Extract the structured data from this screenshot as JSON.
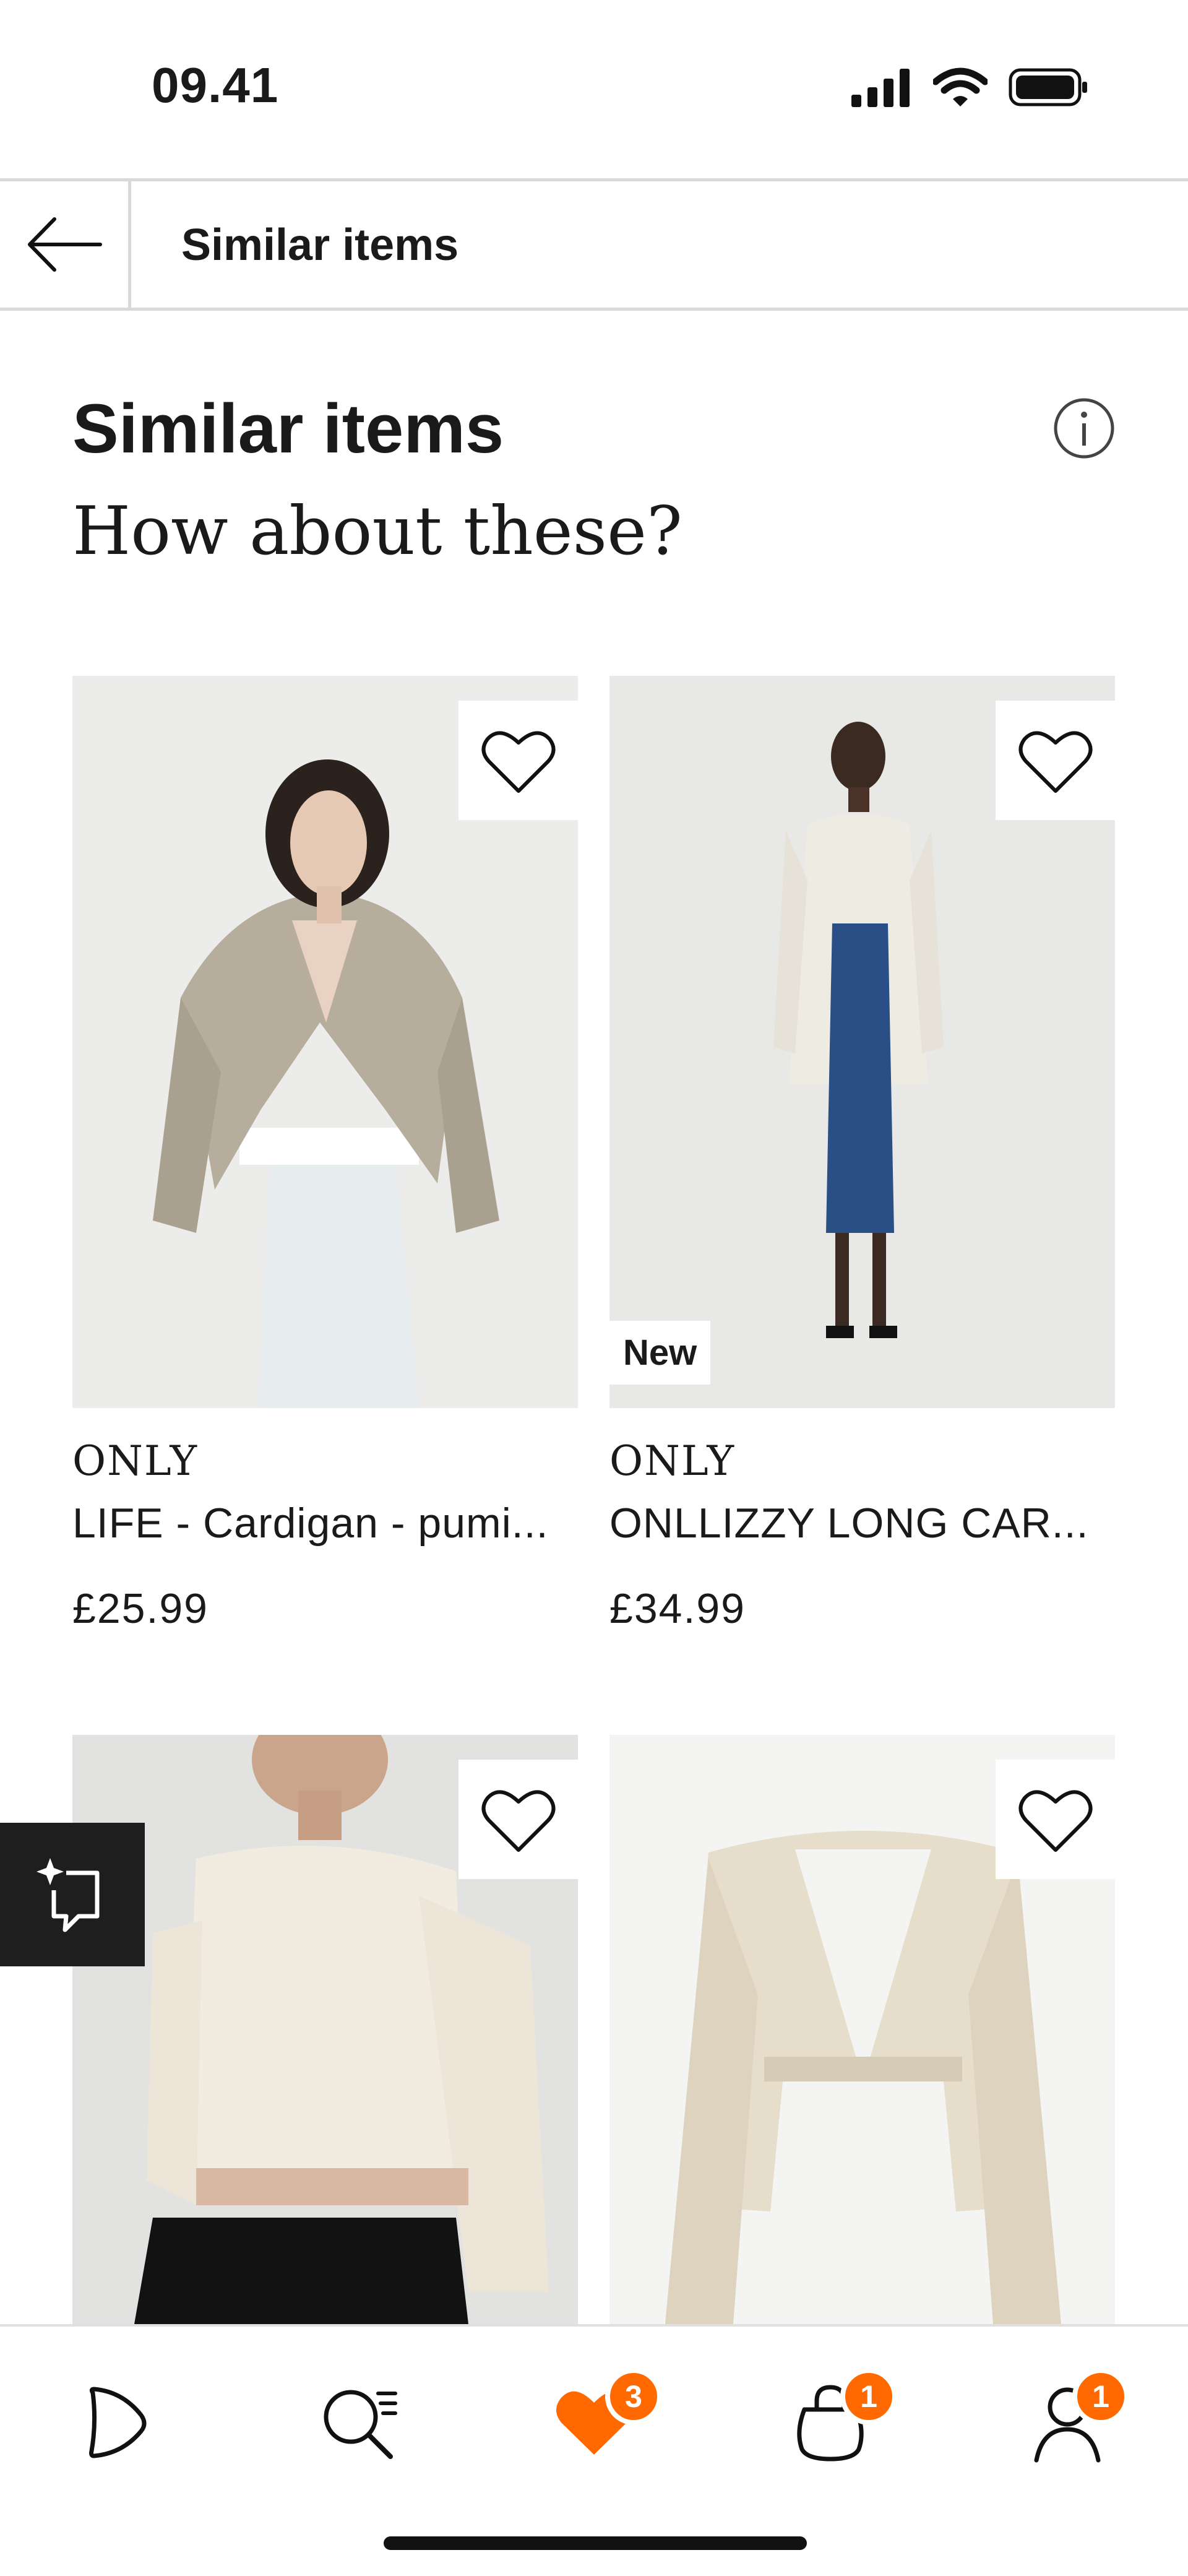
{
  "status_bar": {
    "time": "09.41"
  },
  "header": {
    "title": "Similar items"
  },
  "section": {
    "title": "Similar items",
    "subtitle": "How about these?"
  },
  "products": [
    {
      "brand": "ONLY",
      "name": "LIFE  - Cardigan - pumi...",
      "price": "£25.99",
      "badge": ""
    },
    {
      "brand": "ONLY",
      "name": "ONLLIZZY LONG CAR...",
      "price": "£34.99",
      "badge": "New"
    },
    {
      "brand": "",
      "name": "",
      "price": "",
      "badge": ""
    },
    {
      "brand": "",
      "name": "",
      "price": "",
      "badge": ""
    }
  ],
  "tab_bar": {
    "items": [
      {
        "icon": "home-icon"
      },
      {
        "icon": "search-icon"
      },
      {
        "icon": "heart-icon",
        "badge": "3",
        "active": true
      },
      {
        "icon": "bag-icon",
        "badge": "1"
      },
      {
        "icon": "profile-icon",
        "badge": "1"
      }
    ]
  },
  "colors": {
    "accent": "#ff6900",
    "text": "#1a1a1a",
    "divider": "#d9d9d9"
  }
}
